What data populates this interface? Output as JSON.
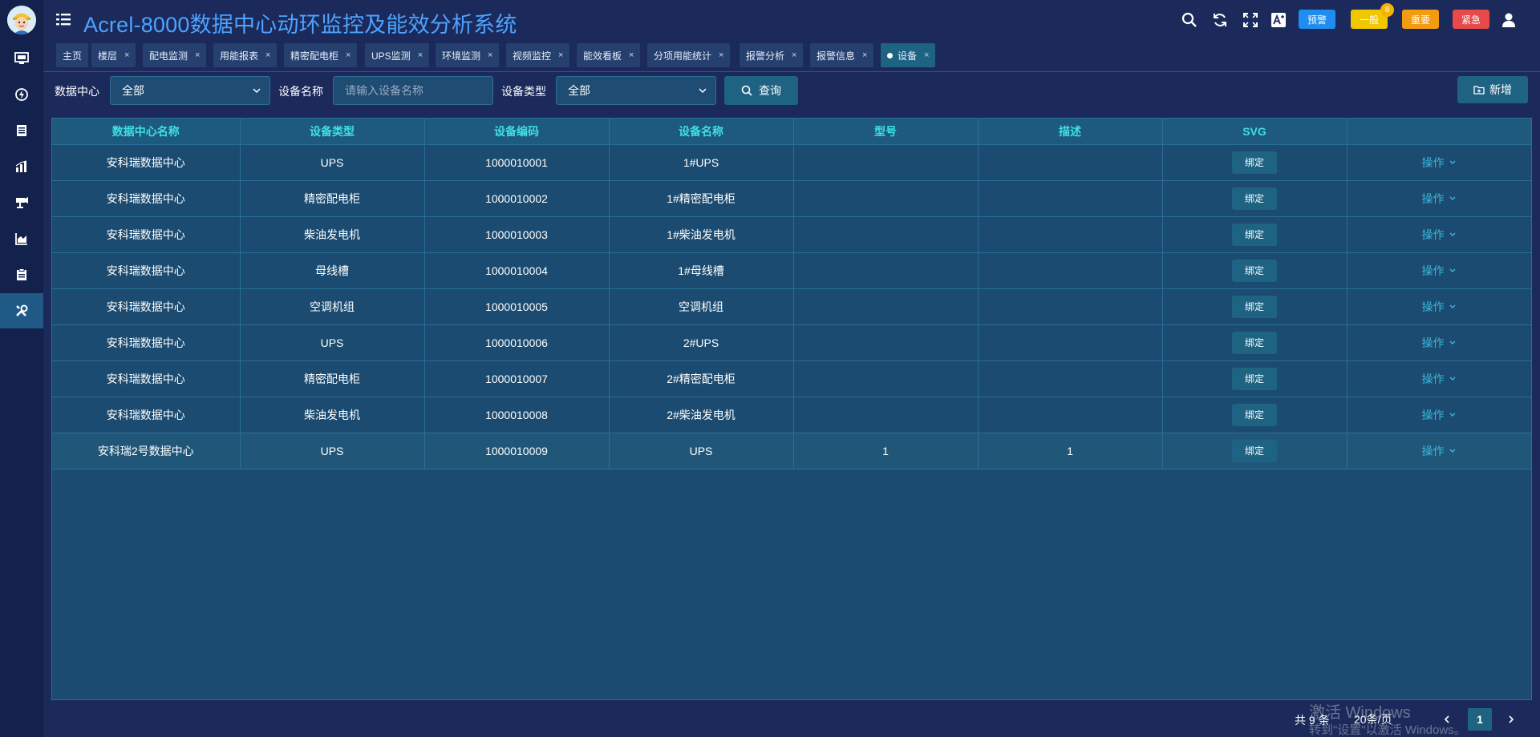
{
  "header": {
    "title": "Acrel-8000数据中心动环监控及能效分析系统",
    "alarm_buttons": [
      {
        "label": "预警",
        "color": "#1f8df0"
      },
      {
        "label": "一般",
        "color": "#f0c800",
        "count": "8"
      },
      {
        "label": "重要",
        "color": "#f39c12"
      },
      {
        "label": "紧急",
        "color": "#e84a4a"
      }
    ]
  },
  "tabs": [
    {
      "label": "主页",
      "closable": false
    },
    {
      "label": "楼层"
    },
    {
      "label": "配电监测"
    },
    {
      "label": "用能报表"
    },
    {
      "label": "精密配电柜"
    },
    {
      "label": "UPS监测"
    },
    {
      "label": "环境监测"
    },
    {
      "label": "视频监控"
    },
    {
      "label": "能效看板"
    },
    {
      "label": "分项用能统计"
    },
    {
      "label": "报警分析"
    },
    {
      "label": "报警信息"
    },
    {
      "label": "设备",
      "active": true
    }
  ],
  "filters": {
    "datacenter_label": "数据中心",
    "datacenter_value": "全部",
    "device_name_label": "设备名称",
    "device_name_placeholder": "请输入设备名称",
    "device_type_label": "设备类型",
    "device_type_value": "全部",
    "query_label": "查询",
    "add_label": "新增"
  },
  "table": {
    "columns": [
      "数据中心名称",
      "设备类型",
      "设备编码",
      "设备名称",
      "型号",
      "描述",
      "SVG",
      ""
    ],
    "bind_label": "绑定",
    "op_label": "操作",
    "rows": [
      [
        "安科瑞数据中心",
        "UPS",
        "1000010001",
        "1#UPS",
        "",
        ""
      ],
      [
        "安科瑞数据中心",
        "精密配电柜",
        "1000010002",
        "1#精密配电柜",
        "",
        ""
      ],
      [
        "安科瑞数据中心",
        "柴油发电机",
        "1000010003",
        "1#柴油发电机",
        "",
        ""
      ],
      [
        "安科瑞数据中心",
        "母线槽",
        "1000010004",
        "1#母线槽",
        "",
        ""
      ],
      [
        "安科瑞数据中心",
        "空调机组",
        "1000010005",
        "空调机组",
        "",
        ""
      ],
      [
        "安科瑞数据中心",
        "UPS",
        "1000010006",
        "2#UPS",
        "",
        ""
      ],
      [
        "安科瑞数据中心",
        "精密配电柜",
        "1000010007",
        "2#精密配电柜",
        "",
        ""
      ],
      [
        "安科瑞数据中心",
        "柴油发电机",
        "1000010008",
        "2#柴油发电机",
        "",
        ""
      ],
      [
        "安科瑞2号数据中心",
        "UPS",
        "1000010009",
        "UPS",
        "1",
        "1"
      ]
    ]
  },
  "pagination": {
    "total": "共 9 条",
    "page_size": "20条/页",
    "current_page": "1"
  },
  "watermark": {
    "line1": "激活 Windows",
    "line2": "转到\"设置\"以激活 Windows。"
  }
}
